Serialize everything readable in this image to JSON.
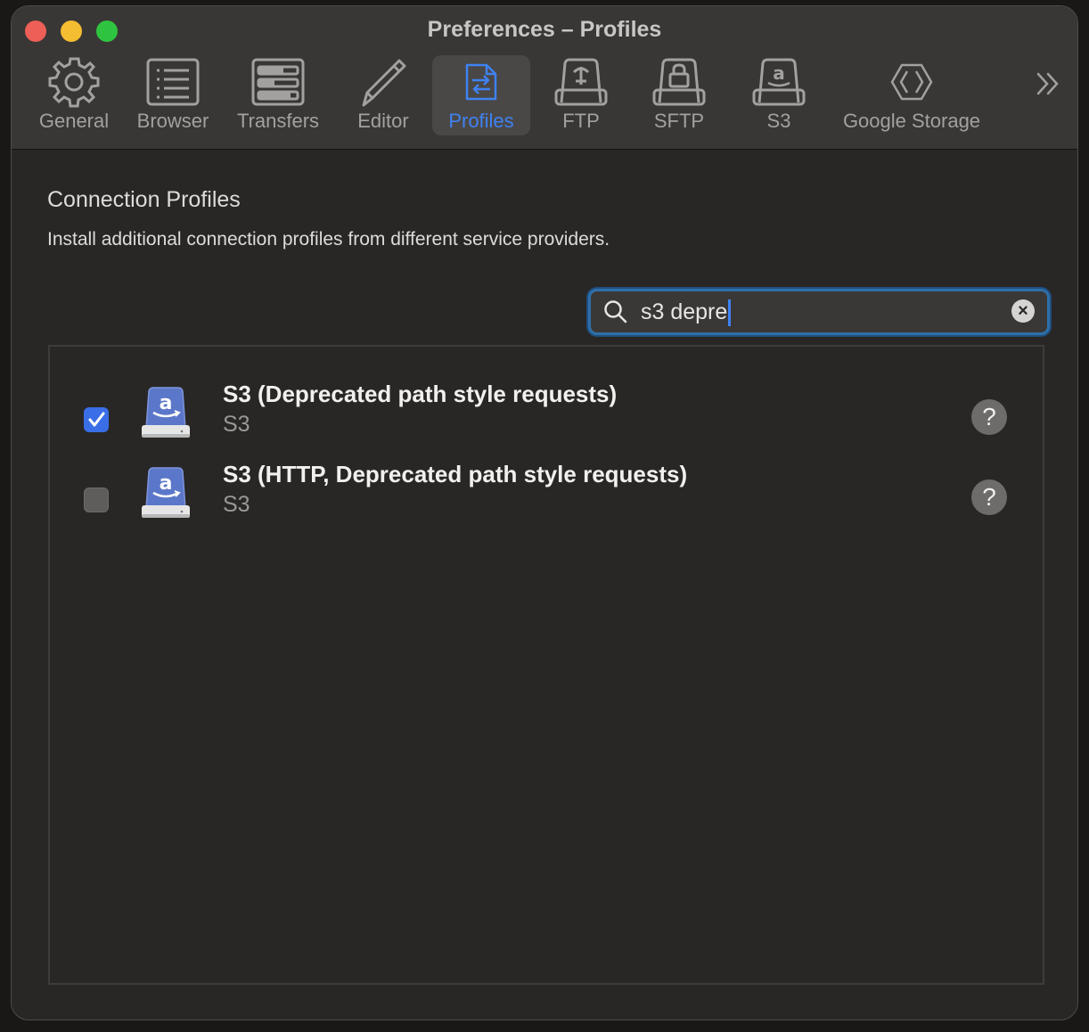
{
  "window": {
    "title": "Preferences – Profiles"
  },
  "toolbar": {
    "items": [
      {
        "label": "General",
        "icon": "gear-icon"
      },
      {
        "label": "Browser",
        "icon": "browser-list-icon"
      },
      {
        "label": "Transfers",
        "icon": "transfers-icon"
      },
      {
        "label": "Editor",
        "icon": "pencil-icon"
      },
      {
        "label": "Profiles",
        "icon": "profiles-icon",
        "active": true
      },
      {
        "label": "FTP",
        "icon": "ftp-drive-icon"
      },
      {
        "label": "SFTP",
        "icon": "sftp-drive-icon"
      },
      {
        "label": "S3",
        "icon": "s3-drive-icon"
      },
      {
        "label": "Google Storage",
        "icon": "google-storage-icon"
      }
    ],
    "overflow": "»"
  },
  "main": {
    "title": "Connection Profiles",
    "description": "Install additional connection profiles from different service providers."
  },
  "search": {
    "value": "s3 depre"
  },
  "profiles": [
    {
      "title": "S3 (Deprecated path style requests)",
      "subtitle": "S3",
      "checked": true,
      "help": "?"
    },
    {
      "title": "S3 (HTTP, Deprecated path style requests)",
      "subtitle": "S3",
      "checked": false,
      "help": "?"
    }
  ],
  "colors": {
    "accent": "#3f82f3",
    "checkbox": "#3a6ee7"
  }
}
